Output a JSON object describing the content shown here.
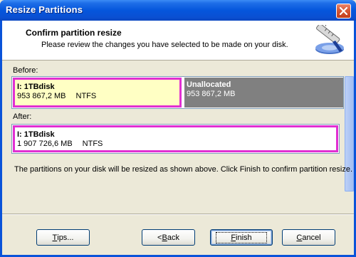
{
  "window": {
    "title": "Resize Partitions"
  },
  "header": {
    "title": "Confirm partition resize",
    "subtitle": "Please review the changes you have selected to be made on your disk.",
    "icon": "resize-tool-icon"
  },
  "before": {
    "label": "Before:",
    "partitions": [
      {
        "name": "I:  1TBdisk",
        "size": "953 867,2 MB",
        "fs": "NTFS",
        "state": "selected"
      },
      {
        "name": "Unallocated",
        "size": "953 867,2 MB",
        "fs": "",
        "state": "unallocated"
      }
    ]
  },
  "after": {
    "label": "After:",
    "partitions": [
      {
        "name": "I:  1TBdisk",
        "size": "1 907 726,6 MB",
        "fs": "NTFS",
        "state": "selected"
      }
    ]
  },
  "info": "The partitions on your disk will be resized as shown above.  Click Finish to confirm partition resize.",
  "buttons": {
    "tips": {
      "prefix": "",
      "accel": "T",
      "rest": "ips..."
    },
    "back": {
      "prefix": "< ",
      "accel": "B",
      "rest": "ack"
    },
    "finish": {
      "prefix": "",
      "accel": "F",
      "rest": "inish"
    },
    "cancel": {
      "prefix": "",
      "accel": "C",
      "rest": "ancel"
    }
  },
  "colors": {
    "titlebar": "#0556dc",
    "selection_border": "#e12fd2",
    "partition_fill": "#ffffc4",
    "unallocated_fill": "#808080",
    "dialog_bg": "#ece9d8"
  }
}
